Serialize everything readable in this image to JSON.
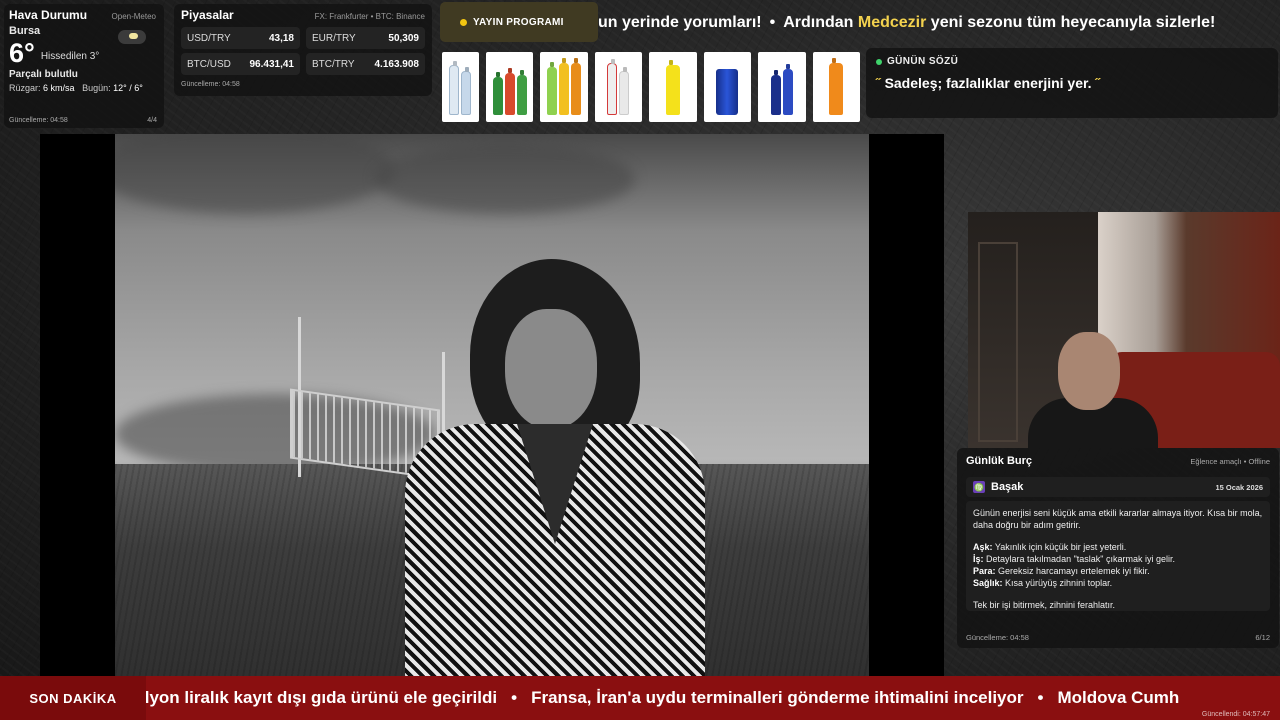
{
  "weather": {
    "title": "Hava Durumu",
    "source": "Open-Meteo",
    "city": "Bursa",
    "temperature": "6°",
    "feels_like": "Hissedilen 3°",
    "condition": "Parçalı bulutlu",
    "wind_label": "Rüzgar:",
    "wind_value": "6 km/sa",
    "today_label": "Bugün:",
    "today_value": "12° / 6°",
    "updated": "Güncelleme: 04:58",
    "page": "4/4",
    "icon": "partly-cloudy-icon"
  },
  "markets": {
    "title": "Piyasalar",
    "source": "FX: Frankfurter • BTC: Binance",
    "items": [
      {
        "symbol": "USD/TRY",
        "value": "43,18"
      },
      {
        "symbol": "EUR/TRY",
        "value": "50,309"
      },
      {
        "symbol": "BTC/USD",
        "value": "96.431,41"
      },
      {
        "symbol": "BTC/TRY",
        "value": "4.163.908"
      }
    ],
    "updated": "Güncelleme: 04:58"
  },
  "schedule": {
    "label": "YAYIN PROGRAMI",
    "accent": "#f2c511"
  },
  "top_ticker": {
    "part1": "un yerinde yorumları!",
    "separator": "•",
    "part2": "Ardından",
    "highlight": "Medcezir",
    "part3": "yeni sezonu tüm heyecanıyla sizlerle!",
    "highlight_color": "#f3d24e"
  },
  "products": [
    {
      "name": "water-bottles",
      "colors": [
        "#dfe9f2",
        "#b7cde3"
      ]
    },
    {
      "name": "green-soda-bottles",
      "colors": [
        "#2f8f3a",
        "#d84a2c",
        "#3f9e43",
        "#e0b530"
      ]
    },
    {
      "name": "flavored-drink-bottles",
      "colors": [
        "#8fd14f",
        "#f2c020",
        "#e88d1a",
        "#8fd14f"
      ]
    },
    {
      "name": "soda-water-bottles",
      "colors": [
        "#e9e9e9",
        "#d43a3a"
      ]
    },
    {
      "name": "lemon-soda-bottle",
      "colors": [
        "#f4e11b"
      ]
    },
    {
      "name": "deep-energy-can",
      "colors": [
        "#1d3fb0"
      ]
    },
    {
      "name": "blue-tonic-bottles",
      "colors": [
        "#1b2f8a",
        "#2c4bc2"
      ]
    },
    {
      "name": "orange-soda-bottle",
      "colors": [
        "#f08a1b"
      ]
    }
  ],
  "quote": {
    "heading": "GÜNÜN SÖZÜ",
    "open_mark": "˝",
    "text": "Sadeleş; fazlalıklar enerjini yer.",
    "close_mark": "˝"
  },
  "horoscope": {
    "title": "Günlük Burç",
    "meta": "Eğlence amaçlı • Offline",
    "sign": "Başak",
    "sign_glyph": "♍",
    "date": "15 Ocak 2026",
    "intro": "Günün enerjisi seni küçük ama etkili kararlar almaya itiyor. Kısa bir mola, daha doğru bir adım getirir.",
    "love_label": "Aşk:",
    "love": "Yakınlık için küçük bir jest yeterli.",
    "work_label": "İş:",
    "work": "Detaylara takılmadan \"taslak\" çıkarmak iyi gelir.",
    "money_label": "Para:",
    "money": "Gereksiz harcamayı ertelemek iyi fikir.",
    "health_label": "Sağlık:",
    "health": "Kısa yürüyüş zihnini toplar.",
    "tip": "Tek bir işi bitirmek, zihnini ferahlatır.",
    "updated": "Güncelleme: 04:58",
    "page": "6/12"
  },
  "breaking": {
    "label": "SON DAKİKA",
    "item1": "ilyon liralık kayıt dışı gıda ürünü ele geçirildi",
    "separator": "•",
    "item2": "Fransa, İran'a uydu terminalleri gönderme ihtimalini inceliyor",
    "item3": "Moldova Cumh",
    "updated": "Güncellendi: 04:57:47",
    "color": "#8a0f10"
  }
}
